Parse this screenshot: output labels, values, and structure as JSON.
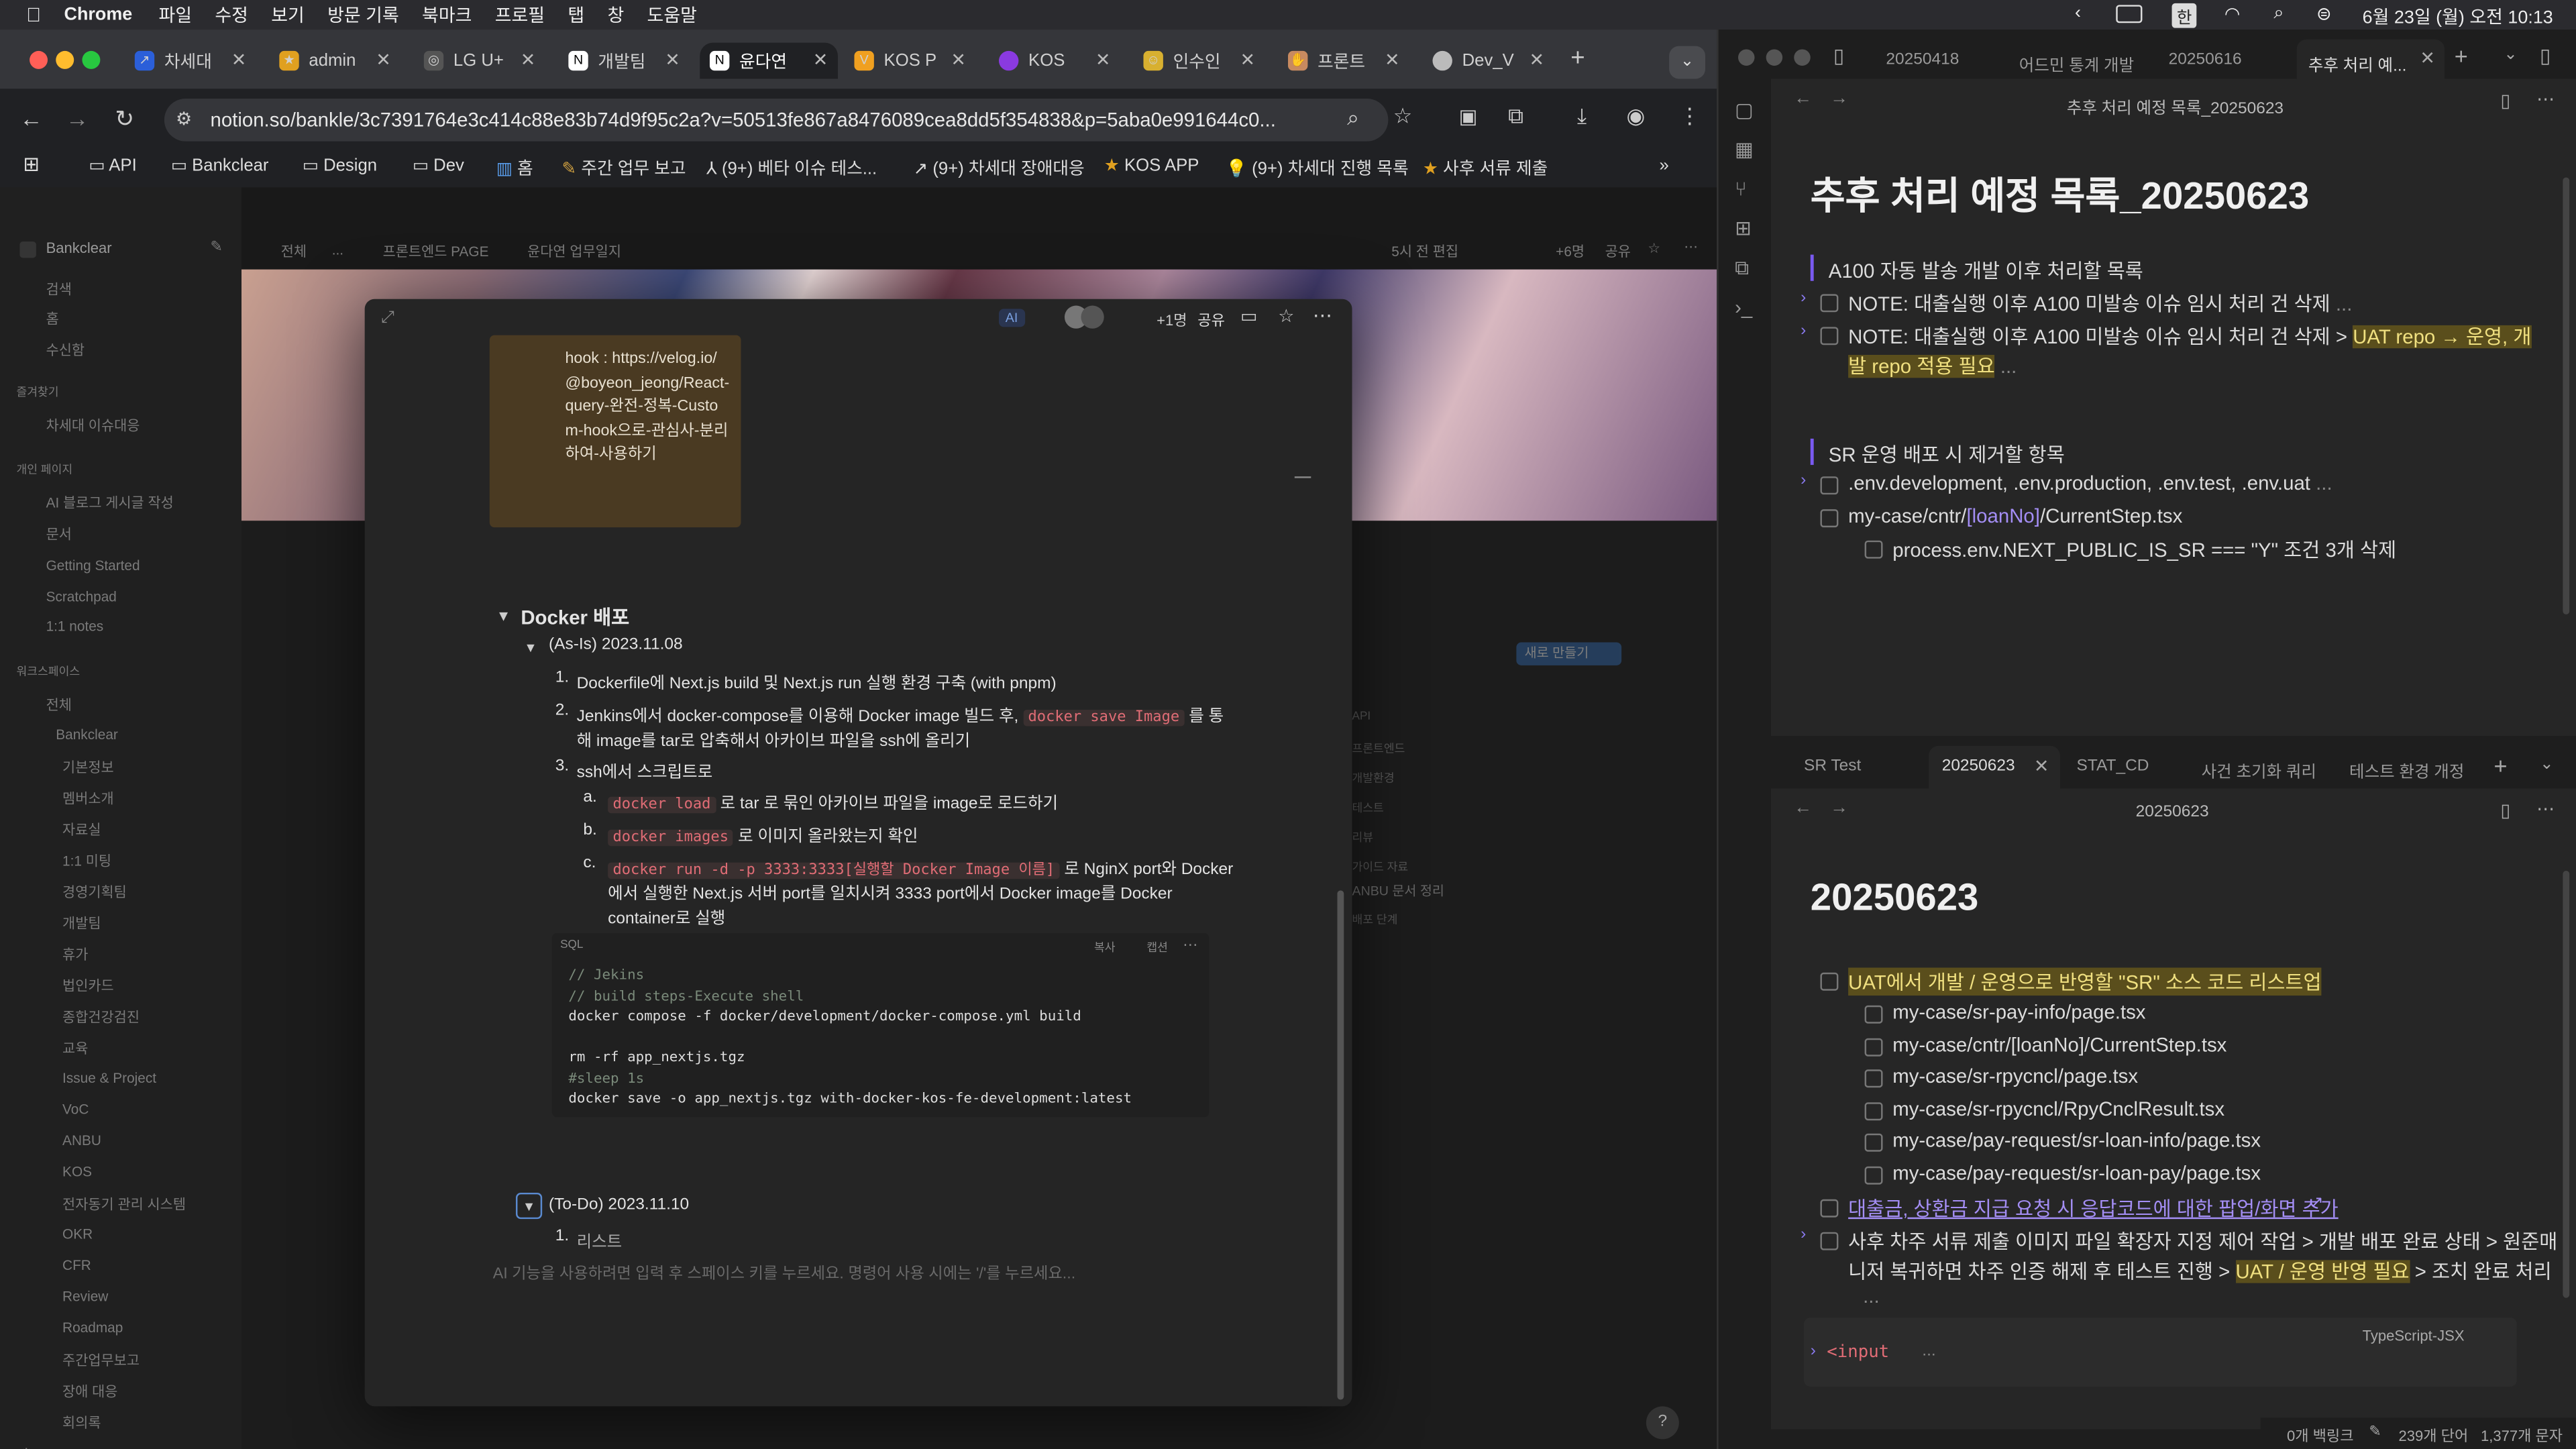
{
  "menubar": {
    "app": "Chrome",
    "items": [
      "파일",
      "수정",
      "보기",
      "방문 기록",
      "북마크",
      "프로필",
      "탭",
      "창",
      "도움말"
    ],
    "datetime": "6월 23일 (월) 오전 10:13",
    "input_mode": "한"
  },
  "chrome": {
    "tabs": [
      "차세대",
      "admin",
      "LG U+",
      "개발팀",
      "윤다연",
      "KOS P",
      "KOS",
      "인수인",
      "프론트",
      "Dev_V"
    ],
    "active_tab_index": 4,
    "url": "notion.so/bankle/3c7391764e3c414c88e83b74d9f95c2a?v=50513fe867a8476089cea8dd5f354838&p=5aba0e991644c0...",
    "bookmarks": [
      "API",
      "Bankclear",
      "Design",
      "Dev",
      "홈",
      "주간 업무 보고",
      "(9+) 베타 이슈 테스...",
      "(9+) 차세대 장애대응",
      "KOS APP",
      "(9+) 차세대 진행 목록",
      "사후 서류 제출"
    ]
  },
  "notion": {
    "workspace": "Bankclear",
    "breadcrumb": [
      "전체",
      "...",
      "프론트엔드 PAGE",
      "윤다연 업무일지"
    ],
    "topbar_right": [
      "5시 전 편집",
      "+6명",
      "공유"
    ],
    "sidebar": {
      "top": [
        "검색",
        "홈",
        "수신함"
      ],
      "fav_head": "즐겨찾기",
      "fav": [
        "차세대 이슈대응"
      ],
      "private_head": "개인 페이지",
      "private": [
        "AI 블로그 게시글 작성",
        "문서",
        "Getting Started",
        "Scratchpad",
        "1:1 notes"
      ],
      "ws_head": "워크스페이스",
      "ws": [
        "전체",
        "Bankclear",
        "기본정보",
        "멤버소개",
        "자료실",
        "1:1 미팅",
        "경영기획팀",
        "개발팀",
        "휴가",
        "법인카드",
        "종합건강검진",
        "교육",
        "Issue & Project",
        "VoC",
        "ANBU",
        "KOS",
        "전자동기 관리 시스템",
        "OKR",
        "CFR",
        "Review",
        "Roadmap",
        "주간업무보고",
        "장애 대응",
        "회의록"
      ]
    },
    "modal": {
      "topbar": {
        "ai": "AI",
        "count": "+1명",
        "share": "공유"
      },
      "callout": "hook : https://velog.io/@boyeon_jeong/React-query-완전-정복-Custom-hook으로-관심사-분리하여-사용하기",
      "h_docker": "Docker 배포",
      "asis": "(As-Is) 2023.11.08",
      "steps": [
        "Dockerfile에 Next.js build 및 Next.js run 실행 환경 구축 (with pnpm)",
        "Jenkins에서 docker-compose를 이용해 Docker image 빌드 후,",
        "해 image를 tar로 압축해서 아카이브 파일을 ssh에 올리기",
        "ssh에서 스크립트로"
      ],
      "step2_code": "docker save Image",
      "step2_tail": "를 통",
      "substeps": [
        {
          "mark": "a.",
          "code": "docker load",
          "text": "로 tar 로 묶인 아카이브 파일을 image로 로드하기"
        },
        {
          "mark": "b.",
          "code": "docker images",
          "text": "로 이미지 올라왔는지 확인"
        },
        {
          "mark": "c.",
          "code": "docker run -d -p 3333:3333[실행할 Docker Image 이름]",
          "text": "로 NginX port와 Docker",
          "text2": "에서 실행한 Next.js 서버 port를 일치시켜 3333 port에서 Docker image를 Docker",
          "text3": "container로 실행"
        }
      ],
      "code_lang": "SQL",
      "code_actions": [
        "복사",
        "캡션"
      ],
      "code": [
        "// Jekins",
        "// build steps-Execute shell",
        "docker compose -f docker/development/docker-compose.yml build",
        "",
        "rm -rf app_nextjs.tgz",
        "#sleep 1s",
        "docker save -o app_nextjs.tgz with-docker-kos-fe-development:latest"
      ],
      "todo": "(To-Do) 2023.11.10",
      "todo_item": "리스트",
      "placeholder": "AI 기능을 사용하려면 입력 후 스페이스 키를 누르세요. 명령어 사용 시에는 '/'를 누르세요..."
    },
    "bg_button": "새로 만들기",
    "bg_items": [
      "API",
      "프론트엔드",
      "개발환경",
      "테스트",
      "리뷰",
      "가이드 자료",
      "ANBU 문서 정리",
      "배포 단계"
    ]
  },
  "obsidian": {
    "top_tabs": [
      "20250418",
      "어드민 통계 개발",
      "20250616",
      "추후 처리 예..."
    ],
    "top_title": "추후 처리 예정 목록_20250623",
    "h1": "추후 처리 예정 목록_20250623",
    "sec1": "A100 자동 발송 개발 이후 처리할 목록",
    "note1": "NOTE: 대출실행 이후 A100 미발송 이슈 임시 처리 건 삭제",
    "note2a": "NOTE: 대출실행 이후 A100 미발송 이슈 임시 처리 건 삭제 > ",
    "note2hl": "UAT repo → 운영, 개",
    "note2b": "발 repo 적용 필요",
    "sec2": "SR 운영 배포 시 제거할 항목",
    "env": ".env.development, .env.production, .env.test, .env.uat",
    "cntr_a": "my-case/cntr/",
    "cntr_b": "[loanNo]",
    "cntr_c": "/CurrentStep.tsx",
    "proc": "process.env.NEXT_PUBLIC_IS_SR === \"Y\" 조건 3개 삭제",
    "bottom_tabs": [
      "SR Test",
      "20250623",
      "STAT_CD",
      "사건 초기화 쿼리",
      "테스트 환경 개정"
    ],
    "bottom_title": "20250623",
    "h2": "20250623",
    "uat": "UAT에서 개발 / 운영으로 반영할 \"SR\" 소스 코드 리스트업",
    "files": [
      "my-case/sr-pay-info/page.tsx",
      "my-case/cntr/[loanNo]/CurrentStep.tsx",
      "my-case/sr-rpycncl/page.tsx",
      "my-case/sr-rpycncl/RpyCnclResult.tsx",
      "my-case/pay-request/sr-loan-info/page.tsx",
      "my-case/pay-request/sr-loan-pay/page.tsx"
    ],
    "link": "대출금, 상환금 지급 요청 시 응답코드에 대한 팝업/화면 추가",
    "task_a": "사후 차주 서류 제출 이미지 파일 확장자 지정 제어 작업 > 개발 배포 완료 상태 > 원준매",
    "task_b1": "니저 복귀하면 차주 인증 해제 후 테스트 진행 > ",
    "task_hl": "UAT / 운영 반영 필요",
    "task_b2": " > 조치 완료 처리",
    "code_lang": "TypeScript-JSX",
    "code_line": "<input",
    "status": [
      "0개 백링크",
      "239개 단어",
      "1,377개 문자"
    ]
  }
}
